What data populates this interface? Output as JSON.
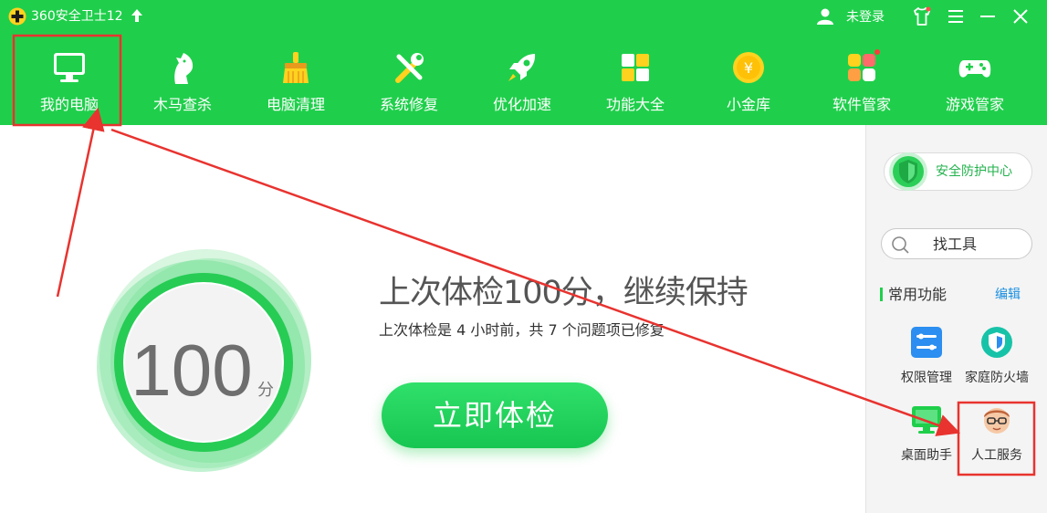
{
  "titlebar": {
    "app_title": "360安全卫士12",
    "login_text": "未登录",
    "icons": [
      "360-logo-icon",
      "upgrade-arrow-icon",
      "user-icon",
      "skin-shirt-icon",
      "menu-icon",
      "minimize-icon",
      "close-icon"
    ]
  },
  "nav": {
    "items": [
      {
        "label": "我的电脑",
        "icon": "computer-icon"
      },
      {
        "label": "木马查杀",
        "icon": "trojan-horse-icon"
      },
      {
        "label": "电脑清理",
        "icon": "broom-icon"
      },
      {
        "label": "系统修复",
        "icon": "repair-tools-icon"
      },
      {
        "label": "优化加速",
        "icon": "rocket-icon"
      },
      {
        "label": "功能大全",
        "icon": "apps-grid-icon"
      },
      {
        "label": "小金库",
        "icon": "gold-coin-icon"
      },
      {
        "label": "软件管家",
        "icon": "software-manager-icon"
      },
      {
        "label": "游戏管家",
        "icon": "gamepad-icon"
      }
    ]
  },
  "main": {
    "score": "100",
    "score_unit": "分",
    "headline": "上次体检100分，继续保持",
    "subline": "上次体检是 4 小时前，共 7 个问题项已修复",
    "check_button": "立即体检"
  },
  "sidebar": {
    "security_center": "安全防护中心",
    "find_tool": "找工具",
    "common_title": "常用功能",
    "edit": "编辑",
    "tools": [
      {
        "label": "权限管理",
        "icon": "permission-settings-icon"
      },
      {
        "label": "家庭防火墙",
        "icon": "home-firewall-icon"
      },
      {
        "label": "桌面助手",
        "icon": "desktop-assistant-icon"
      },
      {
        "label": "人工服务",
        "icon": "customer-service-avatar-icon"
      }
    ]
  },
  "colors": {
    "brand_green": "#1fcf4b",
    "annotation_red": "#e8332f",
    "link_blue": "#1a8fe0"
  }
}
